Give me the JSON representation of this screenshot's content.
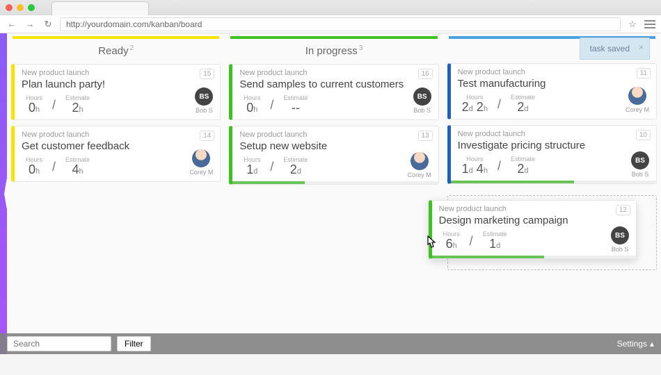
{
  "browser": {
    "url": "http://yourdomain.com/kanban/board"
  },
  "toast": {
    "text": "task saved"
  },
  "columns": [
    {
      "name": "Ready",
      "count": "2",
      "cards": [
        {
          "project": "New product launch",
          "title": "Plan launch party!",
          "num": "15",
          "hours": "0h",
          "estimate": "2h",
          "assignee": "Bob S",
          "avatar_type": "initials",
          "initials": "BS"
        },
        {
          "project": "New product launch",
          "title": "Get customer feedback",
          "num": "14",
          "hours": "0h",
          "estimate": "4h",
          "assignee": "Corey M",
          "avatar_type": "photo"
        }
      ]
    },
    {
      "name": "In progress",
      "count": "3",
      "cards": [
        {
          "project": "New product launch",
          "title": "Send samples to current customers",
          "num": "16",
          "hours": "0h",
          "estimate": "--",
          "assignee": "Bob S",
          "avatar_type": "initials",
          "initials": "BS"
        },
        {
          "project": "New product launch",
          "title": "Setup new website",
          "num": "13",
          "hours": "1d",
          "estimate": "2d",
          "assignee": "Corey M",
          "avatar_type": "photo",
          "progress": 35
        }
      ]
    },
    {
      "name": "",
      "count": "",
      "cards": [
        {
          "project": "New product launch",
          "title": "Test manufacturing",
          "num": "11",
          "hours": "2d 2h",
          "estimate": "2d",
          "assignee": "Corey M",
          "avatar_type": "photo"
        },
        {
          "project": "New product launch",
          "title": "Investigate pricing structure",
          "num": "10",
          "hours": "1d 4h",
          "estimate": "2d",
          "assignee": "Bob S",
          "avatar_type": "initials",
          "initials": "BS",
          "progress": 60
        }
      ],
      "dragging": {
        "project": "New product launch",
        "title": "Design marketing campaign",
        "num": "12",
        "hours": "6h",
        "estimate": "1d",
        "assignee": "Bob S",
        "avatar_type": "initials",
        "initials": "BS",
        "progress": 55
      }
    }
  ],
  "labels": {
    "hours": "Hours",
    "estimate": "Estimate"
  },
  "footer": {
    "search_placeholder": "Search",
    "filter": "Filter",
    "settings": "Settings"
  }
}
